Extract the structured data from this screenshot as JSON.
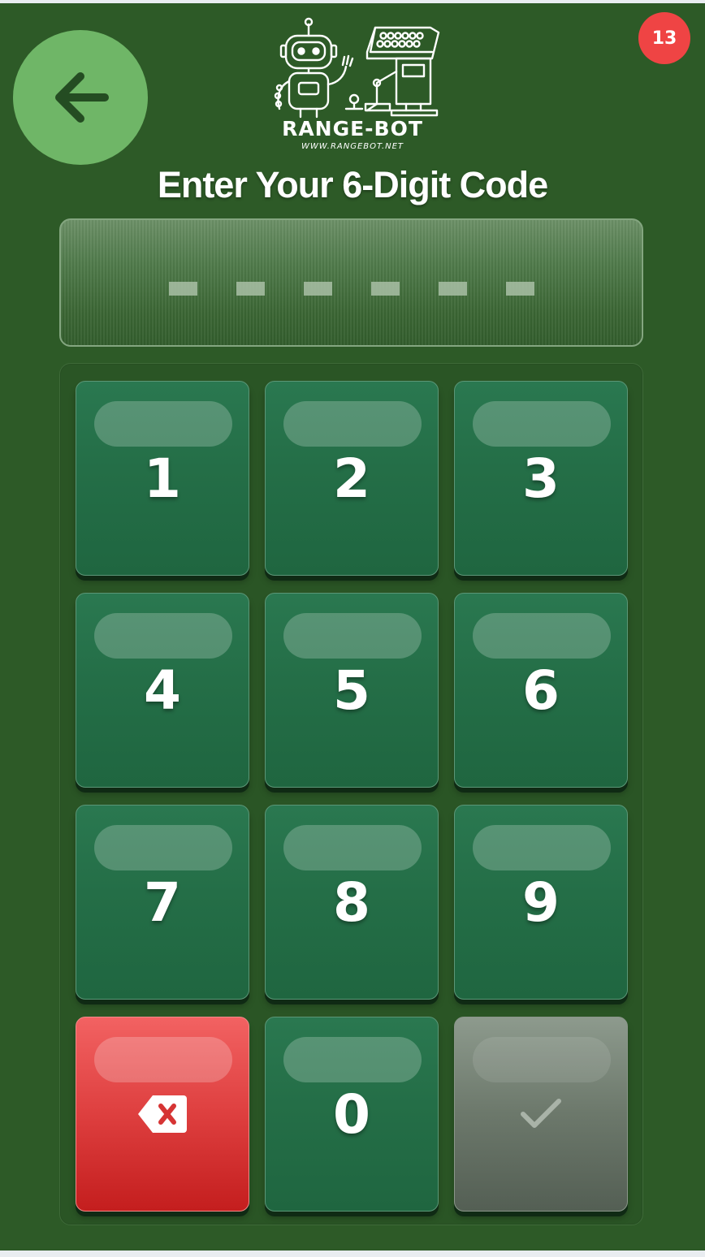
{
  "header": {
    "badge_count": "13",
    "logo": {
      "name": "RANGE-BOT",
      "url": "WWW.RANGEBOT.NET"
    }
  },
  "heading": "Enter Your 6-Digit Code",
  "code": {
    "length": 6,
    "entered": ""
  },
  "keypad": {
    "keys": [
      "1",
      "2",
      "3",
      "4",
      "5",
      "6",
      "7",
      "8",
      "9",
      "0"
    ],
    "delete_icon": "backspace-icon",
    "confirm_icon": "checkmark-icon",
    "confirm_enabled": false
  },
  "icons": {
    "back": "arrow-left-icon"
  },
  "colors": {
    "background": "#2d5a27",
    "back_button": "#6fb667",
    "badge": "#ef4444",
    "key": "#246e47",
    "delete_key": "#de3f3f",
    "confirm_key_disabled": "#6c786b"
  }
}
